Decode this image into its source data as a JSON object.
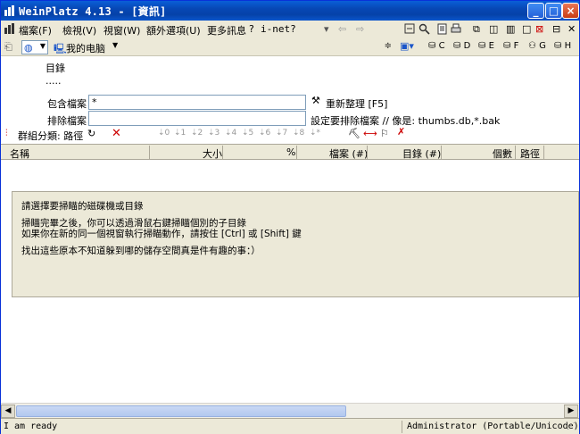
{
  "window": {
    "title": "WeinPlatz 4.13 - [資訊]",
    "controls": {
      "minimize": "_",
      "maximize": "□",
      "close": "×"
    }
  },
  "menu": {
    "items": [
      "檔案(F)",
      "檢視(V)",
      "視窗(W)",
      "額外選項(U)",
      "更多訊息",
      "?",
      "i-net?"
    ]
  },
  "address": {
    "location_label": "我的电脑",
    "drives": [
      "C",
      "D",
      "E",
      "F",
      "G",
      "H"
    ]
  },
  "content": {
    "dir_label": "目錄",
    "dir_value": ".....",
    "include_label": "包含檔案",
    "include_value": "*",
    "refresh_label": "重新整理 [F5]",
    "exclude_label": "排除檔案",
    "exclude_value": "",
    "exclude_hint": "設定要排除檔案 // 像是: thumbs.db,*.bak"
  },
  "group_toolbar": {
    "group_label": "群組分類: 路徑"
  },
  "columns": [
    "名稱",
    "大小",
    "%",
    "檔案 (#)",
    "目錄 (#)",
    "個數",
    "路徑"
  ],
  "info": {
    "line1": "請選擇要掃瞄的磁碟機或目錄",
    "line2": "掃瞄完畢之後，你可以透過滑鼠右鍵掃瞄個別的子目錄",
    "line3": "如果你在新的同一個視窗執行掃瞄動作，請按住 [Ctrl] 或 [Shift] 鍵",
    "line4": "找出這些原本不知道躲到哪的儲存空間真是件有趣的事：）"
  },
  "status": {
    "left": "I am ready",
    "right": "Administrator (Portable/Unicode)"
  }
}
